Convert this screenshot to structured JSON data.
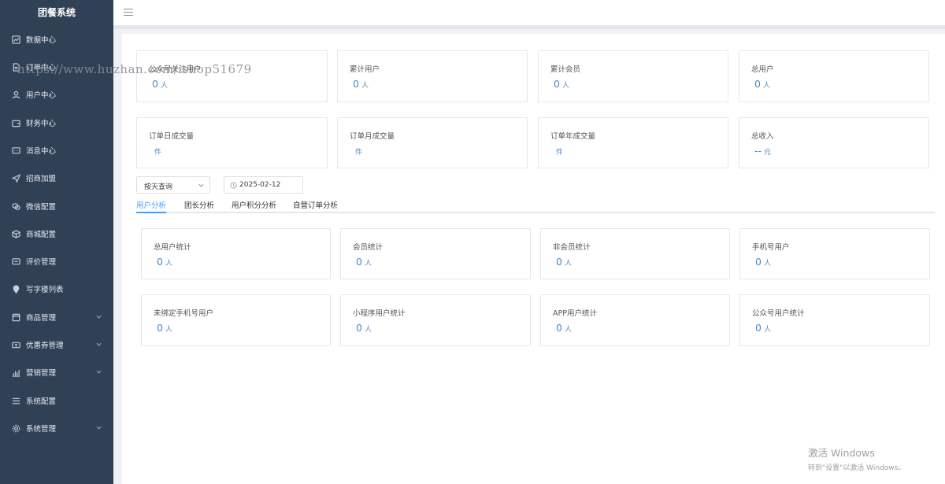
{
  "sidebar": {
    "brand": "团餐系统",
    "items": [
      {
        "label": "数据中心",
        "icon": "chart-icon",
        "has_arrow": false
      },
      {
        "label": "订单中心",
        "icon": "document-icon",
        "has_arrow": false
      },
      {
        "label": "用户中心",
        "icon": "user-icon",
        "has_arrow": false
      },
      {
        "label": "财务中心",
        "icon": "wallet-icon",
        "has_arrow": false
      },
      {
        "label": "消息中心",
        "icon": "message-icon",
        "has_arrow": false
      },
      {
        "label": "招商加盟",
        "icon": "send-icon",
        "has_arrow": false
      },
      {
        "label": "微信配置",
        "icon": "wechat-icon",
        "has_arrow": false
      },
      {
        "label": "商城配置",
        "icon": "box-icon",
        "has_arrow": false
      },
      {
        "label": "评价管理",
        "icon": "comment-icon",
        "has_arrow": false
      },
      {
        "label": "写字楼列表",
        "icon": "location-icon",
        "has_arrow": false
      },
      {
        "label": "商品管理",
        "icon": "shop-icon",
        "has_arrow": true
      },
      {
        "label": "优惠券管理",
        "icon": "coupon-icon",
        "has_arrow": true
      },
      {
        "label": "营销管理",
        "icon": "bar-chart-icon",
        "has_arrow": true
      },
      {
        "label": "系统配置",
        "icon": "list-icon",
        "has_arrow": false
      },
      {
        "label": "系统管理",
        "icon": "gear-icon",
        "has_arrow": true
      }
    ]
  },
  "watermark": "https://www.huzhan.com/ishop51679",
  "summary_cards": [
    {
      "title": "公众号关注用户",
      "value": "0",
      "unit": "人"
    },
    {
      "title": "累计用户",
      "value": "0",
      "unit": "人"
    },
    {
      "title": "累计会员",
      "value": "0",
      "unit": "人"
    },
    {
      "title": "总用户",
      "value": "0",
      "unit": "人"
    },
    {
      "title": "订单日成交量",
      "value": "",
      "unit": "件"
    },
    {
      "title": "订单月成交量",
      "value": "",
      "unit": "件"
    },
    {
      "title": "订单年成交量",
      "value": "",
      "unit": "件"
    },
    {
      "title": "总收入",
      "value": "--",
      "unit": "元"
    }
  ],
  "filter": {
    "query_mode": "按天查询",
    "date": "2025-02-12"
  },
  "tabs": [
    {
      "label": "用户分析",
      "active": true
    },
    {
      "label": "团长分析",
      "active": false
    },
    {
      "label": "用户积分分析",
      "active": false
    },
    {
      "label": "自营订单分析",
      "active": false
    }
  ],
  "analysis_cards": [
    {
      "title": "总用户统计",
      "value": "0",
      "unit": "人"
    },
    {
      "title": "会员统计",
      "value": "0",
      "unit": "人"
    },
    {
      "title": "非会员统计",
      "value": "0",
      "unit": "人"
    },
    {
      "title": "手机号用户",
      "value": "0",
      "unit": "人"
    },
    {
      "title": "未绑定手机号用户",
      "value": "0",
      "unit": "人"
    },
    {
      "title": "小程序用户统计",
      "value": "0",
      "unit": "人"
    },
    {
      "title": "APP用户统计",
      "value": "0",
      "unit": "人"
    },
    {
      "title": "公众号用户统计",
      "value": "0",
      "unit": "人"
    }
  ],
  "windows_activation": {
    "line1": "激活 Windows",
    "line2": "转到\"设置\"以激活 Windows。"
  },
  "colors": {
    "sidebar_bg": "#304156",
    "accent": "#409eff",
    "value_blue": "#4a89c9"
  }
}
